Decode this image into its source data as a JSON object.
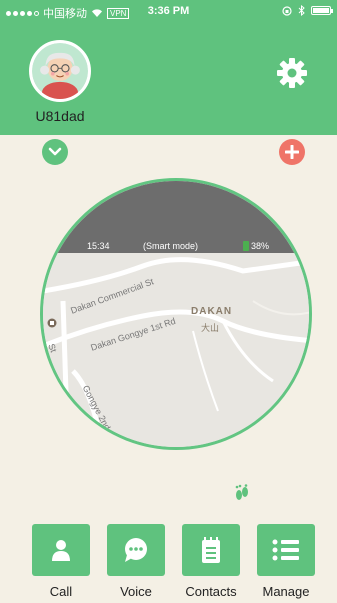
{
  "status_bar": {
    "carrier": "中国移动",
    "vpn": "VPN",
    "time": "3:36 PM"
  },
  "header": {
    "username": "U81dad",
    "avatar_icon": "grandma-avatar",
    "settings_icon": "gear-icon"
  },
  "actions": {
    "left_icon": "chevron-down-icon",
    "right_icon": "plus-icon"
  },
  "map": {
    "time": "15:34",
    "mode": "(Smart mode)",
    "battery": "38%",
    "labels": {
      "road1": "Dakan Commercial St",
      "road2": "Dakan Gongye 1st Rd",
      "road3": "Gongye 2nd",
      "road4": "St",
      "place": "DAKAN",
      "place_cn": "大山"
    }
  },
  "nav": {
    "items": [
      {
        "label": "Call",
        "icon": "phone-person-icon"
      },
      {
        "label": "Voice",
        "icon": "chat-bubble-icon"
      },
      {
        "label": "Contacts",
        "icon": "contacts-icon"
      },
      {
        "label": "Manage",
        "icon": "list-icon"
      }
    ]
  },
  "colors": {
    "primary": "#5fc27e",
    "accent": "#ef7468",
    "background": "#f4f0e5",
    "map_header": "#6d6d6d",
    "pin": "#f28a22"
  }
}
